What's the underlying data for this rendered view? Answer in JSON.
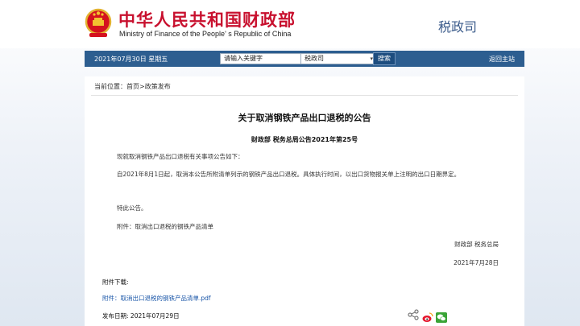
{
  "header": {
    "title_cn": "中华人民共和国财政部",
    "title_en": "Ministry of Finance of the People' s Republic of China",
    "department": "税政司",
    "emblem_icon": "national-emblem-icon"
  },
  "navbar": {
    "date_text": "2021年07月30日  星期五",
    "search_placeholder": "请输入关键字",
    "select_value": "税政司",
    "search_button": "搜索",
    "home_link": "返回主站"
  },
  "breadcrumb": {
    "prefix": "当前位置：",
    "home": "首页",
    "separator": ">",
    "section": "政策发布"
  },
  "article": {
    "title": "关于取消钢铁产品出口退税的公告",
    "subtitle": "财政部  税务总局公告2021年第25号",
    "paragraphs": [
      "现就取消钢铁产品出口退税有关事项公告如下：",
      "自2021年8月1日起，取消本公告所附清单列示的钢铁产品出口退税。具体执行时间，以出口货物报关单上注明的出口日期界定。",
      "特此公告。",
      "附件：取消出口退税的钢铁产品清单"
    ],
    "signature": "财政部    税务总局",
    "sign_date": "2021年7月28日"
  },
  "attachments": {
    "heading": "附件下载:",
    "link": "附件：取消出口退税的钢铁产品清单.pdf"
  },
  "publish": {
    "label": "发布日期:",
    "date": "2021年07月29日"
  },
  "colors": {
    "brand_red": "#c8102e",
    "nav_blue": "#2d5e90",
    "link_blue": "#1a56a8"
  }
}
